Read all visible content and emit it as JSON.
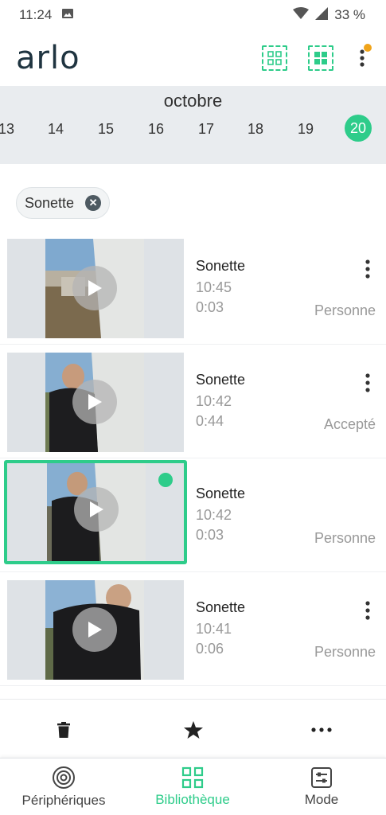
{
  "status_bar": {
    "time": "11:24",
    "battery": "33 %"
  },
  "header": {
    "logo": "arlo"
  },
  "calendar": {
    "month": "octobre",
    "days": [
      "13",
      "14",
      "15",
      "16",
      "17",
      "18",
      "19",
      "20"
    ],
    "selected_day": "20"
  },
  "filter": {
    "label": "Sonette"
  },
  "recordings": [
    {
      "title": "Sonette",
      "time": "10:45",
      "duration": "0:03",
      "status": "Personne"
    },
    {
      "title": "Sonette",
      "time": "10:42",
      "duration": "0:44",
      "status": "Accepté"
    },
    {
      "title": "Sonette",
      "time": "10:42",
      "duration": "0:03",
      "status": "Personne"
    },
    {
      "title": "Sonette",
      "time": "10:41",
      "duration": "0:06",
      "status": "Personne"
    }
  ],
  "bottom_nav": {
    "devices": "Périphériques",
    "library": "Bibliothèque",
    "mode": "Mode"
  },
  "colors": {
    "accent": "#2ecc8a",
    "notification": "#f0a41a",
    "logo": "#1f3440"
  }
}
